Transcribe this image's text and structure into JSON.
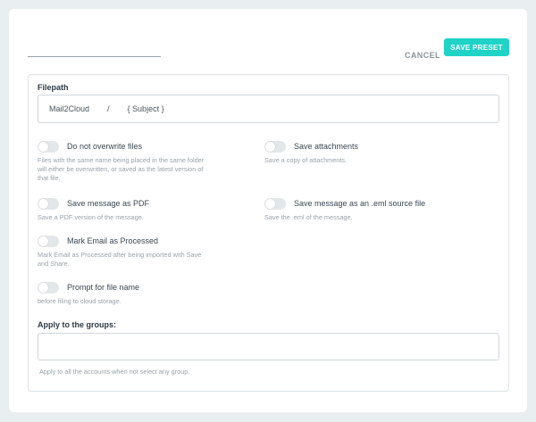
{
  "header": {
    "cancel_label": "CANCEL",
    "save_label": "SAVE PRESET"
  },
  "filepath": {
    "label": "Filepath",
    "segments": [
      "Mail2Cloud",
      "/",
      "{ Subject }"
    ]
  },
  "options": [
    {
      "title": "Do not overwrite files",
      "description": "Files with the same name being placed in the same folder will either be overwritten, or saved as the latest version of that file.",
      "enabled": false
    },
    {
      "title": "Save attachments",
      "description": "Save a copy of attachments.",
      "enabled": false
    },
    {
      "title": "Save message as PDF",
      "description": "Save a PDF version of the message.",
      "enabled": false
    },
    {
      "title": "Save message as an .eml source file",
      "description": "Save the .eml of the message.",
      "enabled": false
    },
    {
      "title": "Mark Email as Processed",
      "description": "Mark Email as Processed after being imported with Save and Share.",
      "enabled": false
    },
    {
      "title": "Prompt for file name",
      "description": "before filing to cloud storage.",
      "enabled": false
    }
  ],
  "groups": {
    "label": "Apply to the groups:",
    "value": "",
    "hint": "Apply to all the accounts when not select any group."
  },
  "colors": {
    "accent": "#1fd3c7",
    "toggle_off": "#e3e7ea",
    "background": "#e9eef1"
  }
}
